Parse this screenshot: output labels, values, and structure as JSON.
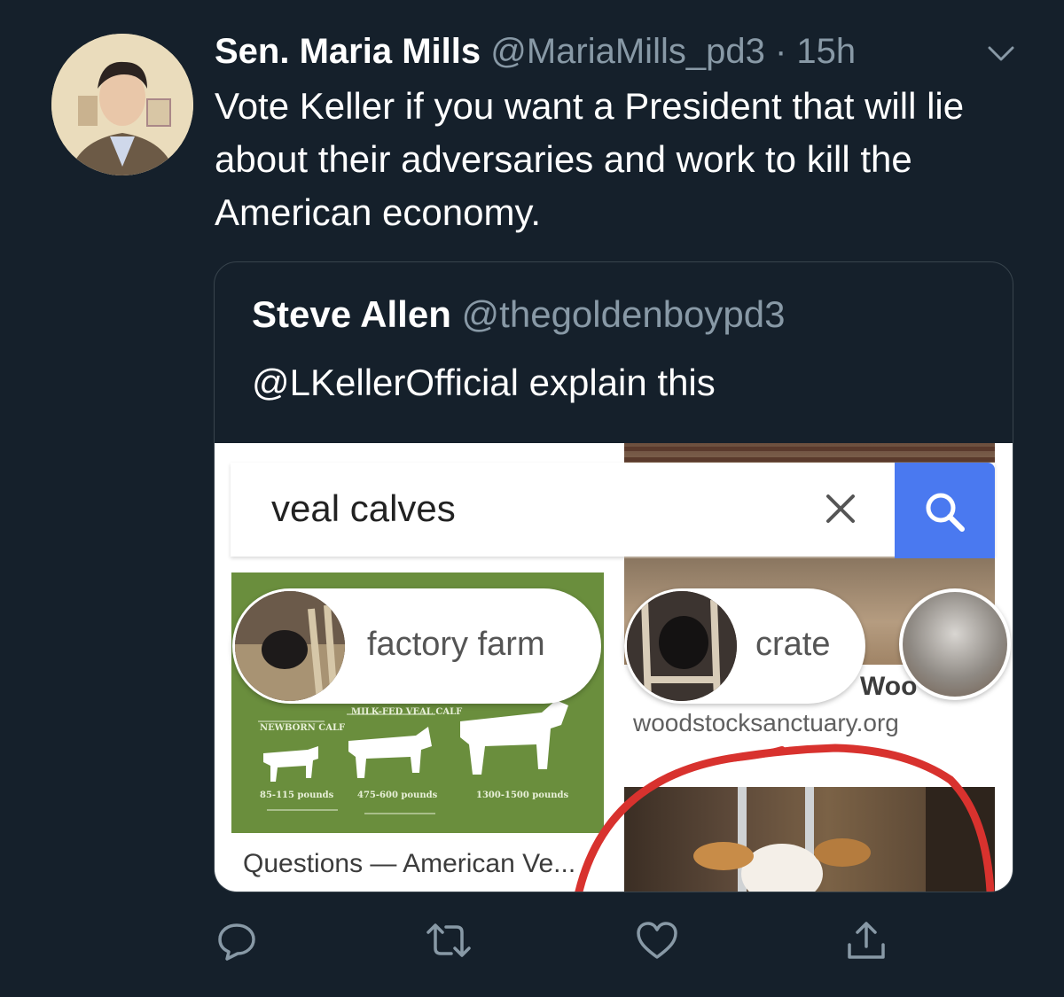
{
  "tweet": {
    "author_name": "Sen. Maria Mills",
    "author_handle": "@MariaMills_pd3",
    "separator": "·",
    "time_ago": "15h",
    "text": "Vote Keller if you want a President that will lie about their adversaries and work to kill the American economy."
  },
  "quoted_tweet": {
    "author_name": "Steve Allen",
    "author_handle": "@thegoldenboypd3",
    "text": "@LKellerOfficial explain this",
    "media": {
      "search_query": "veal calves",
      "chips": [
        {
          "label": "factory farm"
        },
        {
          "label": "crate"
        }
      ],
      "infographic_labels": {
        "milk_fed": "MILK-FED VEAL CALF",
        "newborn": "NEWBORN CALF",
        "w1": "85-115 pounds",
        "w2": "475-600 pounds",
        "w3": "1300-1500 pounds"
      },
      "result_title": "Questions — American Ve...",
      "source_fragment": "Woo",
      "source_site": "woodstocksanctuary.org"
    }
  },
  "colors": {
    "background": "#15202b",
    "secondary_text": "#8899a6",
    "search_blue": "#4a79f0",
    "annotation_red": "#d8322e"
  },
  "icons": {
    "reply": "reply-icon",
    "retweet": "retweet-icon",
    "like": "heart-icon",
    "share": "share-icon",
    "more": "chevron-down-icon"
  }
}
